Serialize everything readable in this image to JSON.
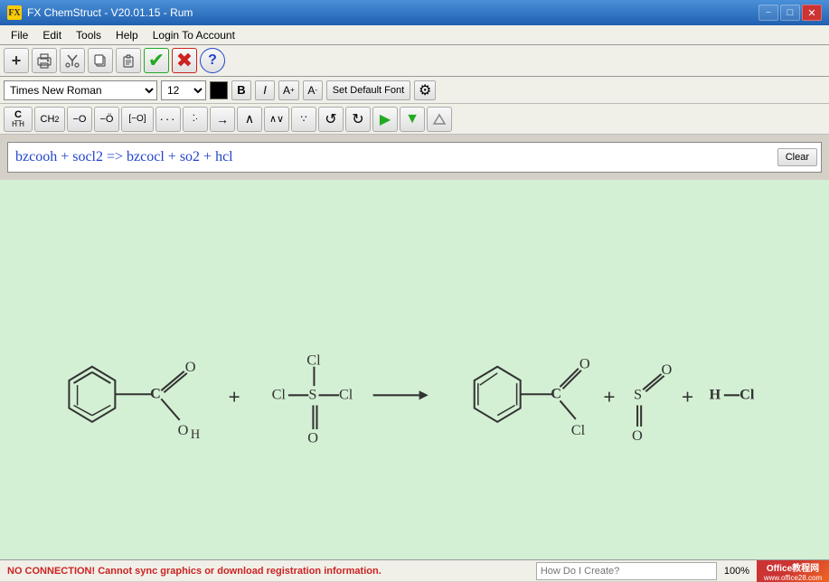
{
  "titleBar": {
    "icon": "FX",
    "title": "FX ChemStruct - V20.01.15 - Rum",
    "minimizeLabel": "−",
    "maximizeLabel": "□",
    "closeLabel": "✕"
  },
  "menuBar": {
    "items": [
      "File",
      "Edit",
      "Tools",
      "Help",
      "Login To Account"
    ]
  },
  "toolbar": {
    "buttons": [
      {
        "name": "add",
        "icon": "+"
      },
      {
        "name": "print",
        "icon": "🖨"
      },
      {
        "name": "cut",
        "icon": "✂"
      },
      {
        "name": "copy",
        "icon": "📋"
      },
      {
        "name": "paste",
        "icon": "📄"
      },
      {
        "name": "check",
        "icon": "✔"
      },
      {
        "name": "cancel",
        "icon": "✖"
      },
      {
        "name": "help",
        "icon": "?"
      }
    ]
  },
  "fontToolbar": {
    "fontName": "Times New Roman",
    "fontSize": "12",
    "boldLabel": "B",
    "italicLabel": "I",
    "superscriptLabel": "A",
    "subscriptLabel": "A",
    "setDefaultLabel": "Set Default Font",
    "gearIcon": "⚙"
  },
  "symbolToolbar": {
    "buttons": [
      {
        "name": "ch-group",
        "label": "C\nH H"
      },
      {
        "name": "ch2-group",
        "label": "CH₂"
      },
      {
        "name": "o-single",
        "label": "−O"
      },
      {
        "name": "o-double",
        "label": "−O̤"
      },
      {
        "name": "bracket-o",
        "label": "[−O]"
      },
      {
        "name": "dots",
        "label": "···"
      },
      {
        "name": "dot-pair",
        "label": "·⁚·"
      },
      {
        "name": "arrow-right",
        "label": "→"
      },
      {
        "name": "angle-up",
        "label": "∧"
      },
      {
        "name": "angle-sym",
        "label": "∧∨"
      },
      {
        "name": "triple-dot",
        "label": "∵"
      },
      {
        "name": "undo",
        "label": "↺"
      },
      {
        "name": "redo",
        "label": "↻"
      },
      {
        "name": "arrow-right2",
        "label": "▶"
      },
      {
        "name": "arrow-down",
        "label": "▼"
      },
      {
        "name": "eraser",
        "label": "⬜"
      }
    ]
  },
  "textInput": {
    "value": "bzcooh + socl2 => bzcocl + so2 + hcl",
    "clearLabel": "Clear"
  },
  "statusBar": {
    "message": "NO CONNECTION! Cannot sync graphics or download registration information.",
    "searchPlaceholder": "How Do I Create?",
    "zoom": "100%",
    "logoLine1": "Office教程网",
    "logoLine2": "www.office28.com"
  }
}
